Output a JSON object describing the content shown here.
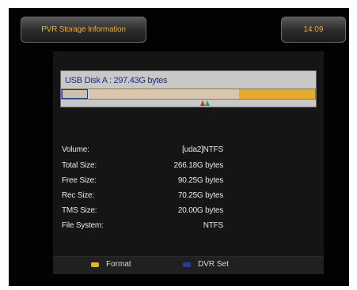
{
  "header": {
    "title": "PVR Storage Information",
    "time": "14:09"
  },
  "disk": {
    "label": "USB Disk A : 297.43G bytes"
  },
  "info": [
    {
      "label": "Volume:",
      "value": "[uda2]NTFS"
    },
    {
      "label": "Total Size:",
      "value": "266.18G bytes"
    },
    {
      "label": "Free Size:",
      "value": "90.25G bytes"
    },
    {
      "label": "Rec Size:",
      "value": "70.25G bytes"
    },
    {
      "label": "TMS Size:",
      "value": "20.00G bytes"
    },
    {
      "label": "File System:",
      "value": "NTFS"
    }
  ],
  "footer": {
    "format_label": "Format",
    "dvr_label": "DVR Set"
  },
  "colors": {
    "accent_text": "#f0a830",
    "format_key": "#e8b020",
    "dvr_key": "#1f3fa0"
  }
}
